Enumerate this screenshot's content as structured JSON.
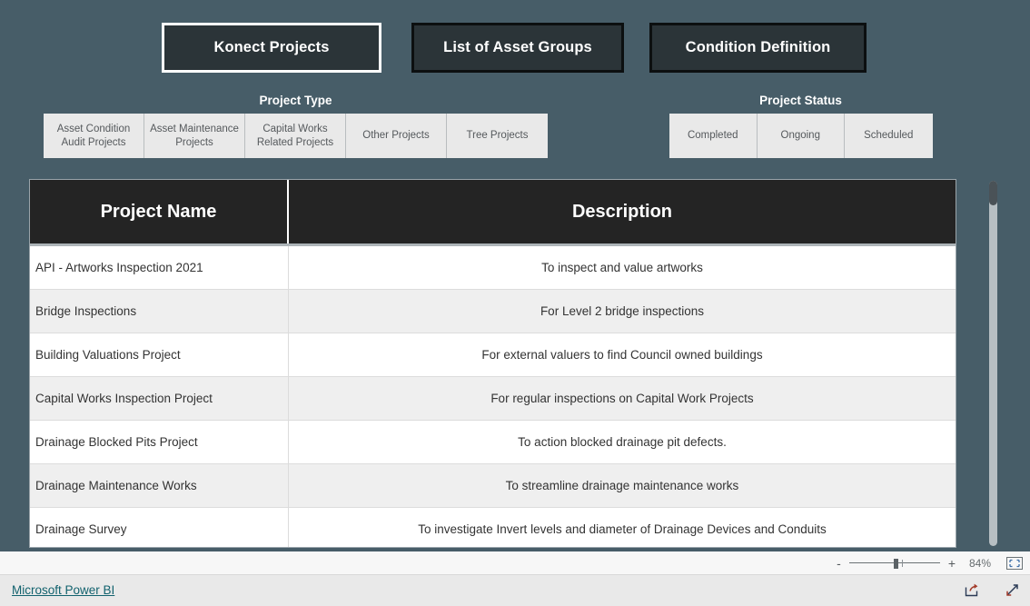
{
  "report": {
    "nav_buttons": [
      {
        "label": "Konect Projects",
        "selected": true
      },
      {
        "label": "List of Asset Groups",
        "selected": false
      },
      {
        "label": "Condition Definition",
        "selected": false
      }
    ],
    "slicers": [
      {
        "title": "Project Type",
        "options": [
          "Asset Condition Audit Projects",
          "Asset Maintenance Projects",
          "Capital Works Related Projects",
          "Other Projects",
          "Tree Projects"
        ]
      },
      {
        "title": "Project Status",
        "options": [
          "Completed",
          "Ongoing",
          "Scheduled"
        ]
      }
    ],
    "table": {
      "columns": [
        "Project Name",
        "Description"
      ],
      "rows": [
        [
          "API - Artworks Inspection 2021",
          "To inspect and value artworks"
        ],
        [
          "Bridge Inspections",
          "For Level 2 bridge inspections"
        ],
        [
          "Building Valuations Project",
          "For external valuers to find Council owned buildings"
        ],
        [
          "Capital Works Inspection Project",
          "For regular inspections on Capital Work Projects"
        ],
        [
          "Drainage Blocked Pits Project",
          "To action blocked drainage pit defects."
        ],
        [
          "Drainage Maintenance Works",
          "To streamline drainage maintenance works"
        ],
        [
          "Drainage Survey",
          "To investigate Invert levels and diameter of Drainage Devices and Conduits"
        ]
      ]
    }
  },
  "chrome": {
    "zoom": {
      "decrease_label": "-",
      "increase_label": "+",
      "level": "84%",
      "fit_icon": "fit-to-page-icon"
    },
    "footer": {
      "link_label": "Microsoft Power BI",
      "share_icon": "share-icon",
      "fullscreen_icon": "fullscreen-icon"
    }
  },
  "colors": {
    "canvas_background": "#475d68",
    "nav_button_fill": "#2b3438",
    "nav_button_border": "#0c0f10",
    "nav_button_selected_border": "#ffffff",
    "slicer_tile_fill": "#e9e9e9",
    "table_header_fill": "#242424",
    "row_alt_fill": "#efefef",
    "link": "#12626e"
  }
}
